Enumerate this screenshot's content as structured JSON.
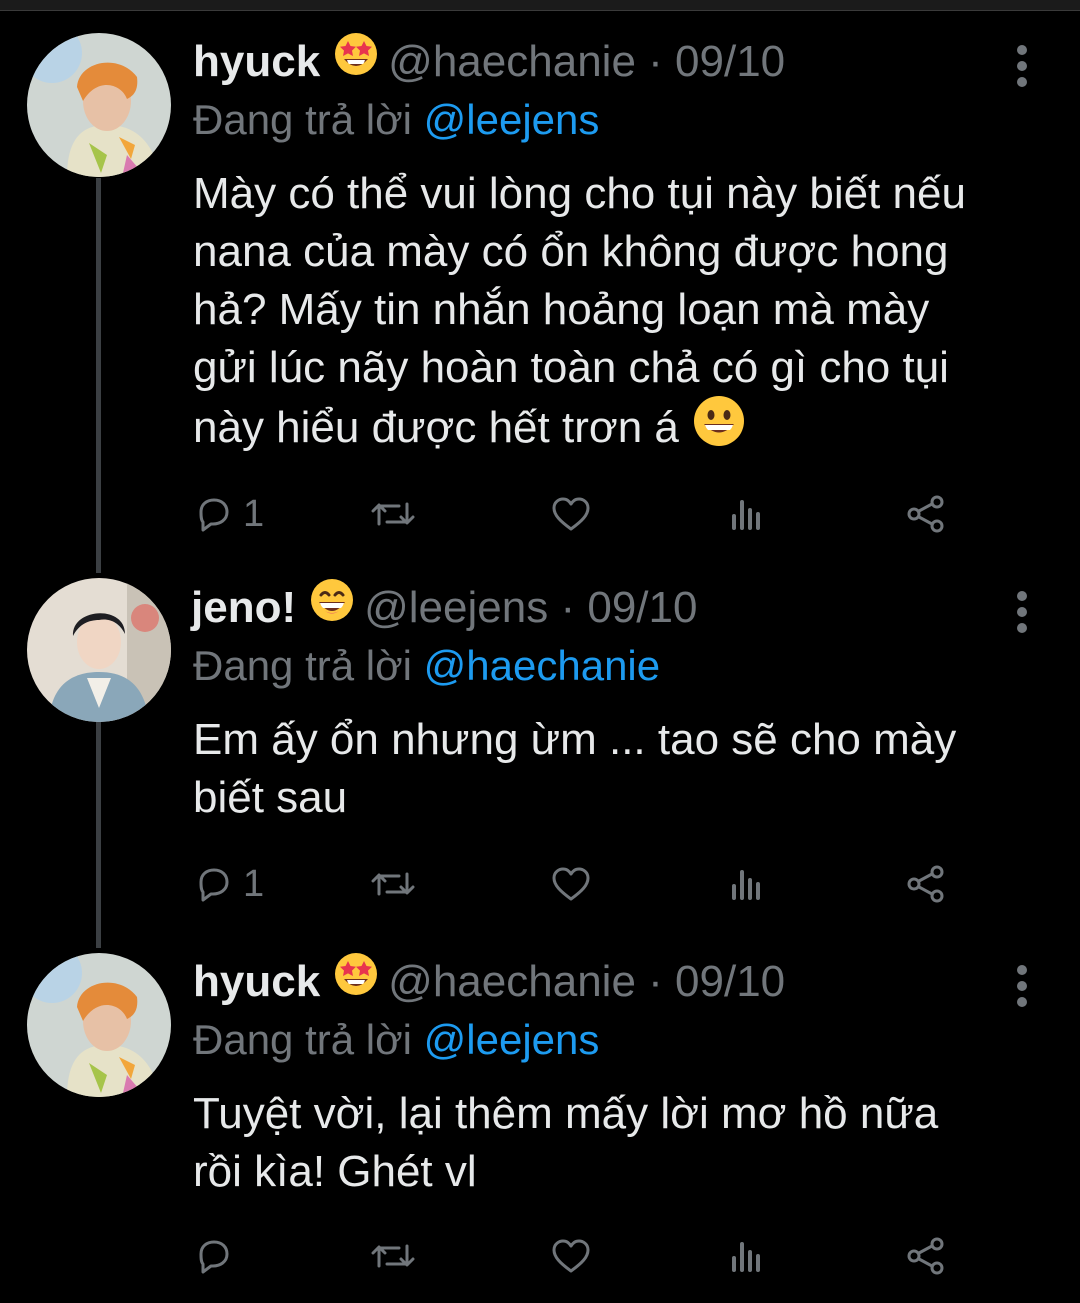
{
  "tweets": [
    {
      "name": "hyuck",
      "name_emoji": "star-struck-emoji",
      "handle": "@haechanie",
      "separator": "·",
      "date": "09/10",
      "replying_prefix": "Đang trả lời",
      "replying_to": "@leejens",
      "text_lines": [
        "Mày có thể vui lòng cho tụi này biết nếu",
        "nana của mày có ổn không được hong",
        "hả? Mấy tin nhắn hoảng loạn mà mày",
        "gửi lúc nãy hoàn toàn chả có gì cho tụi",
        "này hiểu được hết trơn á"
      ],
      "text_end_emoji": "grinning-face-emoji",
      "reply_count": "1",
      "retweet_count": "",
      "like_count": ""
    },
    {
      "name": "jeno!",
      "name_emoji": "grinning-squinting-emoji",
      "handle": "@leejens",
      "separator": "·",
      "date": "09/10",
      "replying_prefix": "Đang trả lời",
      "replying_to": "@haechanie",
      "text_lines": [
        "Em ấy ổn nhưng ừm ... tao sẽ cho mày",
        "biết sau"
      ],
      "reply_count": "1",
      "retweet_count": "",
      "like_count": ""
    },
    {
      "name": "hyuck",
      "name_emoji": "star-struck-emoji",
      "handle": "@haechanie",
      "separator": "·",
      "date": "09/10",
      "replying_prefix": "Đang trả lời",
      "replying_to": "@leejens",
      "text_lines": [
        "Tuyệt vời, lại thêm mấy lời mơ hồ nữa",
        "rồi kìa! Ghét vl"
      ],
      "reply_count": "",
      "retweet_count": "",
      "like_count": ""
    }
  ],
  "colors": {
    "background": "#000000",
    "text": "#e7e9ea",
    "muted": "#71767b",
    "link": "#1d9bf0",
    "thread_line": "#3b3f43"
  },
  "icons": [
    "reply-icon",
    "retweet-icon",
    "like-icon",
    "analytics-icon",
    "share-icon",
    "more-options-icon"
  ]
}
